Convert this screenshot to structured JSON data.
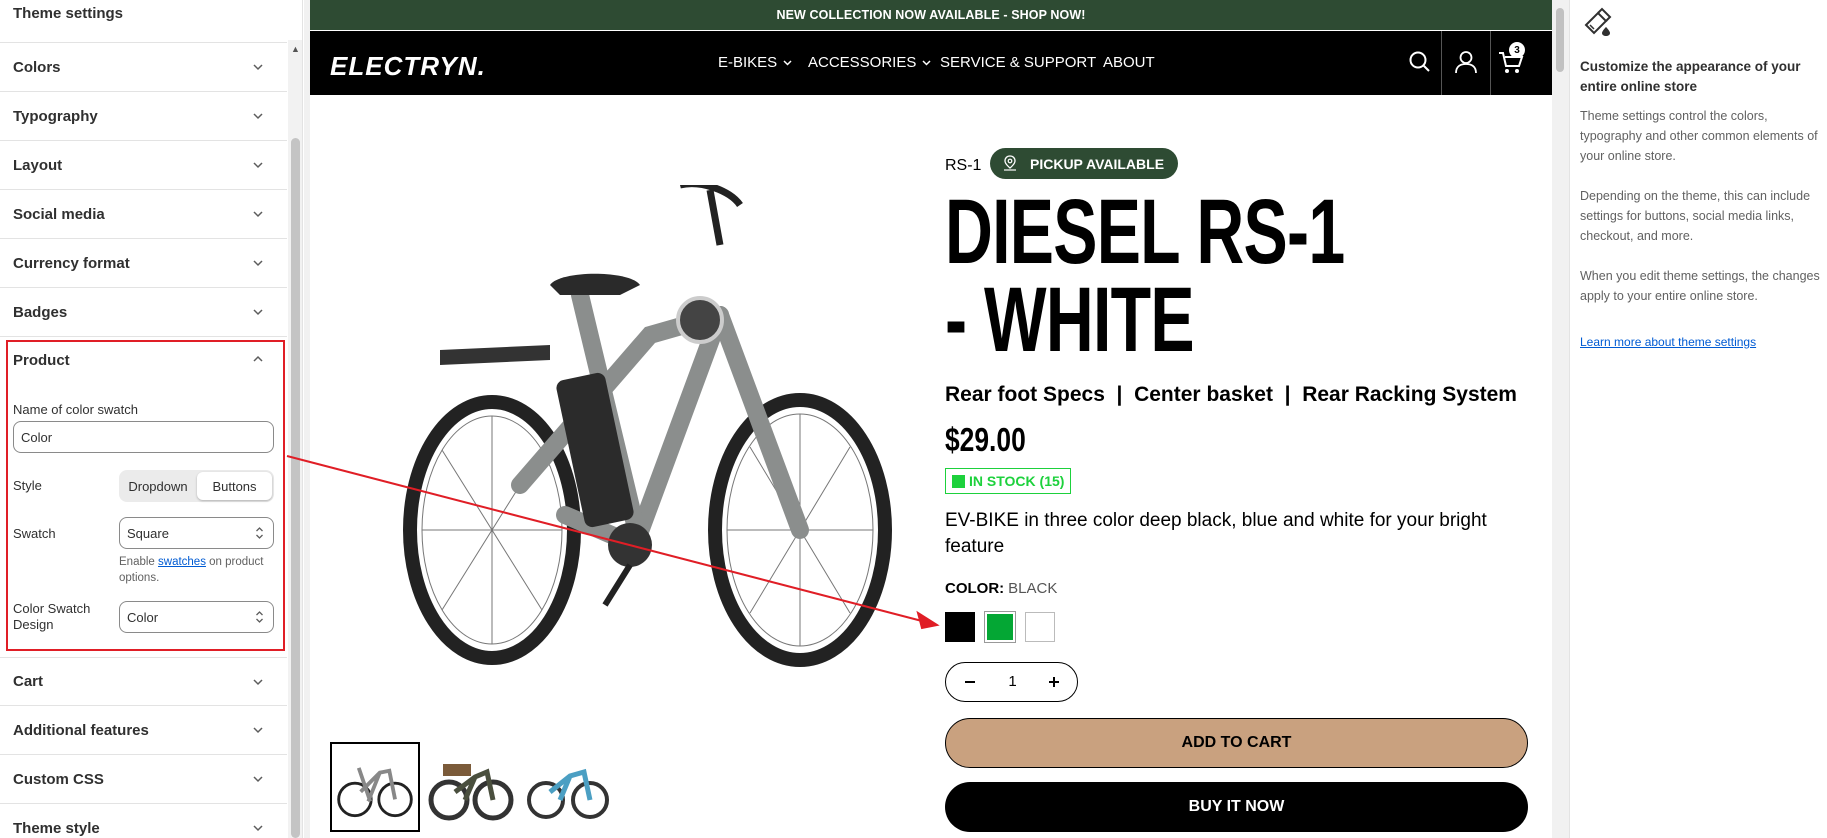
{
  "sidebar": {
    "title": "Theme settings",
    "sections": [
      {
        "label": "Colors"
      },
      {
        "label": "Typography"
      },
      {
        "label": "Layout"
      },
      {
        "label": "Social media"
      },
      {
        "label": "Currency format"
      },
      {
        "label": "Badges"
      }
    ],
    "product": {
      "label": "Product",
      "swatch_name_label": "Name of color swatch",
      "swatch_name_value": "Color",
      "style_label": "Style",
      "style_options": [
        "Dropdown",
        "Buttons"
      ],
      "style_selected": "Buttons",
      "swatch_label": "Swatch",
      "swatch_value": "Square",
      "swatch_help_prefix": "Enable",
      "swatch_help_link": "swatches",
      "swatch_help_suffix": "on product options.",
      "design_label": "Color Swatch Design",
      "design_value": "Color"
    },
    "sections_after": [
      {
        "label": "Cart"
      },
      {
        "label": "Additional features"
      },
      {
        "label": "Custom CSS"
      },
      {
        "label": "Theme style"
      }
    ]
  },
  "store": {
    "announcement": "NEW COLLECTION NOW AVAILABLE - SHOP NOW!",
    "logo": "ELECTRYN.",
    "nav": [
      "E-BIKES",
      "ACCESSORIES",
      "SERVICE & SUPPORT",
      "ABOUT"
    ],
    "cart_count": "3",
    "product": {
      "sku": "RS-1",
      "pickup": "PICKUP AVAILABLE",
      "title": "DIESEL RS-1 - WHITE",
      "features": "Rear foot Specs  |  Center basket  |  Rear Racking System",
      "price": "$29.00",
      "stock": "IN STOCK (15)",
      "description": "EV-BIKE in three color deep black, blue and white for your bright feature",
      "color_label": "COLOR:",
      "color_value": "BLACK",
      "swatches": [
        {
          "name": "black",
          "color": "#000000"
        },
        {
          "name": "green",
          "color": "#04a734"
        },
        {
          "name": "white",
          "color": "#ffffff"
        }
      ],
      "quantity": "1",
      "add_to_cart": "ADD TO CART",
      "buy_now": "BUY IT NOW"
    }
  },
  "info_panel": {
    "heading": "Customize the appearance of your entire online store",
    "para1": "Theme settings control the colors, typography and other common elements of your online store.",
    "para2": "Depending on the theme, this can include settings for buttons, social media links, checkout, and more.",
    "para3": "When you edit theme settings, the changes apply to your entire online store.",
    "link": "Learn more about theme settings"
  },
  "colors": {
    "announce_bg": "#2e4b33",
    "highlight": "#e01e26",
    "add_to_cart_bg": "#c9a17f",
    "stock_green": "#1dd13c"
  }
}
